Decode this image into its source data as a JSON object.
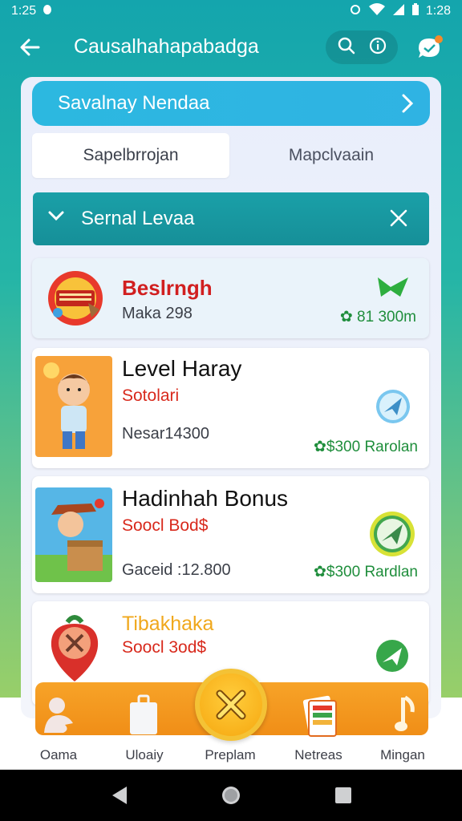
{
  "status_bar": {
    "time": "1:25",
    "clock_right": "1:28"
  },
  "app_bar": {
    "title": "Causalhahapabadga"
  },
  "banner": {
    "label": "Savalnay Nendaa"
  },
  "tabs": [
    {
      "label": "Sapelbrrojan",
      "active": true
    },
    {
      "label": "Mapclvaain",
      "active": false
    }
  ],
  "section": {
    "label": "Sernal Levaa"
  },
  "items": [
    {
      "title": "Beslrngh",
      "meta": "Maka 298",
      "price": "81 300m"
    },
    {
      "title": "Level Haray",
      "subtitle": "Sotolari",
      "meta": "Nesar14300",
      "price": "$300 Rarolan"
    },
    {
      "title": "Hadinhah Bonus",
      "subtitle": "Soocl Bod$",
      "meta": "Gaceid :12.800",
      "price": "$300 Rardlan"
    },
    {
      "title": "Tibakhaka",
      "subtitle": "Soocl 3od$"
    }
  ],
  "bottom_nav": [
    {
      "label": "Oama",
      "icon": "user-silhouette-icon"
    },
    {
      "label": "Uloaiy",
      "icon": "bag-icon"
    },
    {
      "label": "Preplam",
      "icon": "close-x-icon"
    },
    {
      "label": "Netreas",
      "icon": "card-stack-icon"
    },
    {
      "label": "Mingan",
      "icon": "music-note-icon"
    }
  ],
  "colors": {
    "header_teal": "#14a5ad",
    "banner_blue": "#2cb8e0",
    "section_teal": "#1aa0a8",
    "accent_red": "#d8291c",
    "price_green": "#1f8e3c",
    "nav_orange": "#f39a1f"
  }
}
